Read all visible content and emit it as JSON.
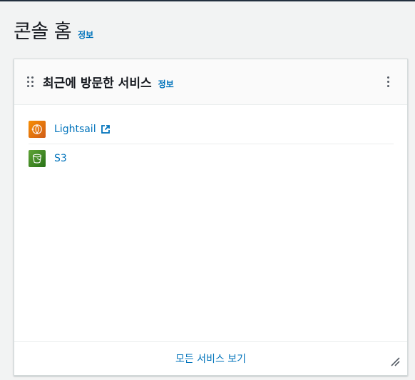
{
  "page": {
    "title": "콘솔 홈",
    "info_label": "정보"
  },
  "widget": {
    "title": "최근에 방문한 서비스",
    "info_label": "정보",
    "services": [
      {
        "label": "Lightsail",
        "icon": "lightsail-icon",
        "color": "#e57a0c",
        "external": true
      },
      {
        "label": "S3",
        "icon": "s3-icon",
        "color": "#3f8624",
        "external": false
      }
    ],
    "footer_link": "모든 서비스 보기"
  },
  "colors": {
    "link": "#0073bb",
    "background": "#f2f3f3",
    "text": "#16191f"
  }
}
